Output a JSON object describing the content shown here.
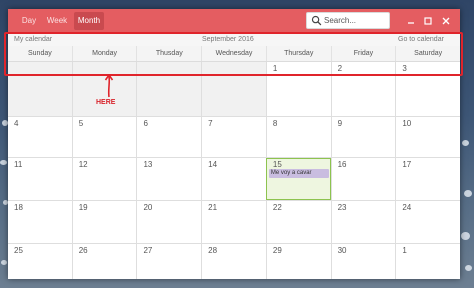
{
  "header": {
    "views": [
      {
        "label": "Day"
      },
      {
        "label": "Week"
      },
      {
        "label": "Month"
      }
    ],
    "active_view": "Month",
    "search": {
      "placeholder": "Search..."
    },
    "window_controls": [
      "minimize-icon",
      "maximize-icon",
      "close-icon"
    ],
    "accent_color": "#e45d61"
  },
  "subheader": {
    "left": "My calendar",
    "center": "September 2016",
    "right": "Go to calendar"
  },
  "weekdays": [
    "Sunday",
    "Monday",
    "Thusday",
    "Wednesday",
    "Thursday",
    "Friday",
    "Saturday"
  ],
  "weeks": [
    [
      {
        "day": "",
        "out": true
      },
      {
        "day": "",
        "out": true
      },
      {
        "day": "",
        "out": true
      },
      {
        "day": "",
        "out": true
      },
      {
        "day": "1"
      },
      {
        "day": "2"
      },
      {
        "day": "3"
      }
    ],
    [
      {
        "day": "4"
      },
      {
        "day": "5"
      },
      {
        "day": "6"
      },
      {
        "day": "7"
      },
      {
        "day": "8"
      },
      {
        "day": "9"
      },
      {
        "day": "10"
      }
    ],
    [
      {
        "day": "11"
      },
      {
        "day": "12"
      },
      {
        "day": "13"
      },
      {
        "day": "14"
      },
      {
        "day": "15",
        "today": true,
        "event": "Me voy a cavar"
      },
      {
        "day": "16"
      },
      {
        "day": "17"
      }
    ],
    [
      {
        "day": "18"
      },
      {
        "day": "19"
      },
      {
        "day": "20"
      },
      {
        "day": "21"
      },
      {
        "day": "22"
      },
      {
        "day": "23"
      },
      {
        "day": "24"
      }
    ],
    [
      {
        "day": "25"
      },
      {
        "day": "26"
      },
      {
        "day": "27"
      },
      {
        "day": "28"
      },
      {
        "day": "29"
      },
      {
        "day": "30"
      },
      {
        "day": "1"
      }
    ]
  ],
  "annotation": {
    "label": "HERE",
    "color": "#e0242b"
  }
}
